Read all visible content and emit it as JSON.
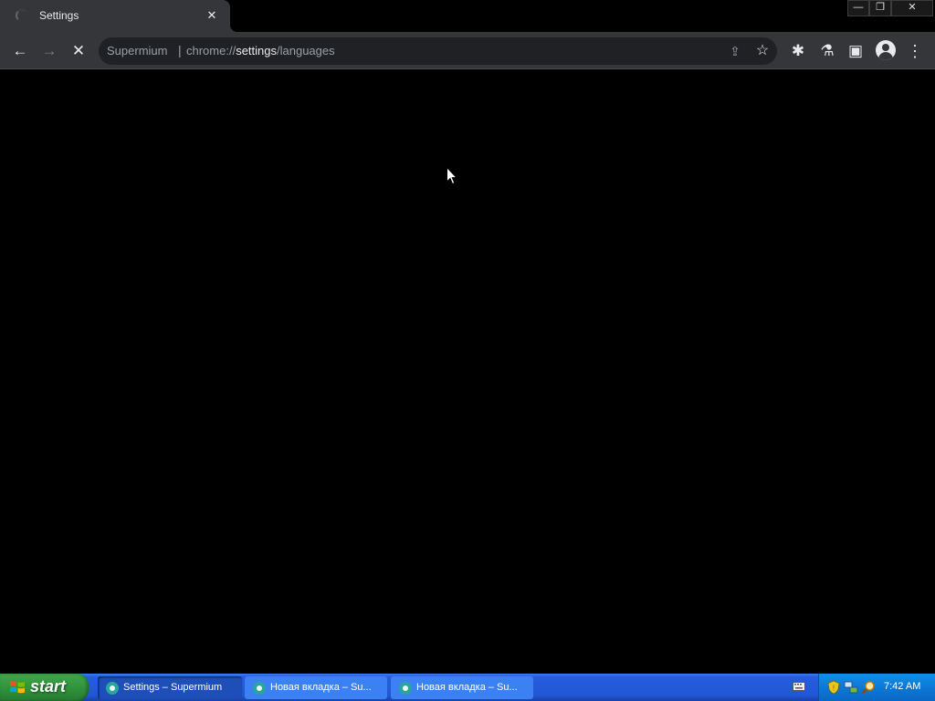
{
  "tab": {
    "title": "Settings",
    "close": "✕"
  },
  "window_controls": {
    "minimize": "—",
    "maximize": "❐",
    "close": "✕"
  },
  "toolbar": {
    "back": "←",
    "forward": "→",
    "stop": "✕",
    "site_name": "Supermium",
    "separator": "|",
    "url_scheme": "chrome://",
    "url_host": "settings",
    "url_path": "/languages",
    "share": "⇪",
    "bookmark_star": "☆",
    "extensions": "✱",
    "labs": "⚗",
    "side_panel": "▣",
    "menu": "⋮"
  },
  "taskbar": {
    "start_label": "start",
    "tasks": [
      {
        "label": "Settings – Supermium",
        "active": true
      },
      {
        "label": "Новая вкладка – Su...",
        "active": false
      },
      {
        "label": "Новая вкладка – Su...",
        "active": false
      }
    ],
    "clock": "7:42 AM"
  },
  "colors": {
    "tab_bg": "#35363a",
    "omnibox_bg": "#202124",
    "taskbar_blue": "#245edb",
    "start_green": "#2f8f3a",
    "tray_blue": "#0c78d6"
  }
}
